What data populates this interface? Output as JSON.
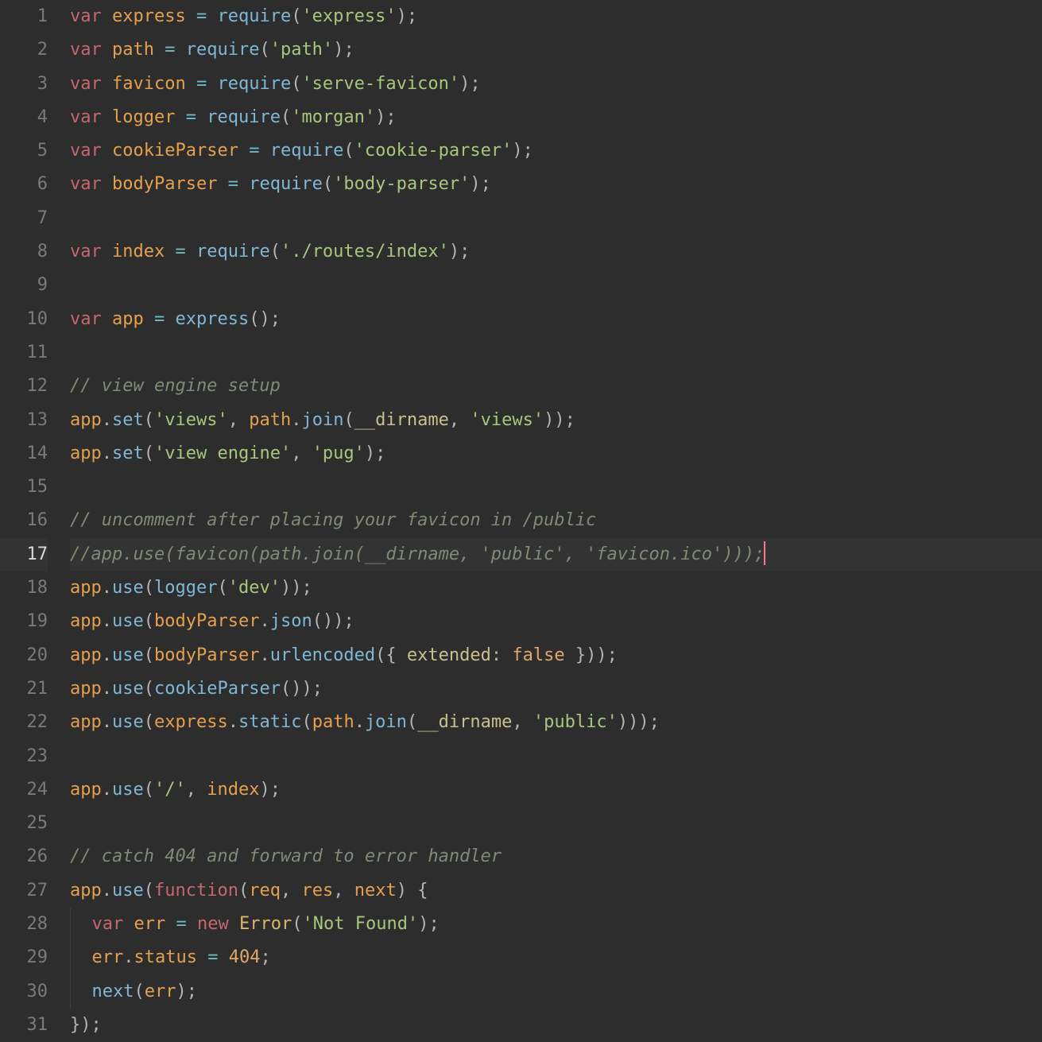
{
  "editor": {
    "current_line": 17,
    "lines": [
      {
        "n": 1,
        "tokens": [
          [
            "kw",
            "var"
          ],
          [
            "sp",
            " "
          ],
          [
            "id",
            "express"
          ],
          [
            "sp",
            " "
          ],
          [
            "op",
            "="
          ],
          [
            "sp",
            " "
          ],
          [
            "call",
            "require"
          ],
          [
            "punc",
            "("
          ],
          [
            "str",
            "'express'"
          ],
          [
            "punc",
            ")"
          ],
          [
            "punc",
            ";"
          ]
        ]
      },
      {
        "n": 2,
        "tokens": [
          [
            "kw",
            "var"
          ],
          [
            "sp",
            " "
          ],
          [
            "id",
            "path"
          ],
          [
            "sp",
            " "
          ],
          [
            "op",
            "="
          ],
          [
            "sp",
            " "
          ],
          [
            "call",
            "require"
          ],
          [
            "punc",
            "("
          ],
          [
            "str",
            "'path'"
          ],
          [
            "punc",
            ")"
          ],
          [
            "punc",
            ";"
          ]
        ]
      },
      {
        "n": 3,
        "tokens": [
          [
            "kw",
            "var"
          ],
          [
            "sp",
            " "
          ],
          [
            "id",
            "favicon"
          ],
          [
            "sp",
            " "
          ],
          [
            "op",
            "="
          ],
          [
            "sp",
            " "
          ],
          [
            "call",
            "require"
          ],
          [
            "punc",
            "("
          ],
          [
            "str",
            "'serve-favicon'"
          ],
          [
            "punc",
            ")"
          ],
          [
            "punc",
            ";"
          ]
        ]
      },
      {
        "n": 4,
        "tokens": [
          [
            "kw",
            "var"
          ],
          [
            "sp",
            " "
          ],
          [
            "id",
            "logger"
          ],
          [
            "sp",
            " "
          ],
          [
            "op",
            "="
          ],
          [
            "sp",
            " "
          ],
          [
            "call",
            "require"
          ],
          [
            "punc",
            "("
          ],
          [
            "str",
            "'morgan'"
          ],
          [
            "punc",
            ")"
          ],
          [
            "punc",
            ";"
          ]
        ]
      },
      {
        "n": 5,
        "tokens": [
          [
            "kw",
            "var"
          ],
          [
            "sp",
            " "
          ],
          [
            "id",
            "cookieParser"
          ],
          [
            "sp",
            " "
          ],
          [
            "op",
            "="
          ],
          [
            "sp",
            " "
          ],
          [
            "call",
            "require"
          ],
          [
            "punc",
            "("
          ],
          [
            "str",
            "'cookie-parser'"
          ],
          [
            "punc",
            ")"
          ],
          [
            "punc",
            ";"
          ]
        ]
      },
      {
        "n": 6,
        "tokens": [
          [
            "kw",
            "var"
          ],
          [
            "sp",
            " "
          ],
          [
            "id",
            "bodyParser"
          ],
          [
            "sp",
            " "
          ],
          [
            "op",
            "="
          ],
          [
            "sp",
            " "
          ],
          [
            "call",
            "require"
          ],
          [
            "punc",
            "("
          ],
          [
            "str",
            "'body-parser'"
          ],
          [
            "punc",
            ")"
          ],
          [
            "punc",
            ";"
          ]
        ]
      },
      {
        "n": 7,
        "tokens": []
      },
      {
        "n": 8,
        "tokens": [
          [
            "kw",
            "var"
          ],
          [
            "sp",
            " "
          ],
          [
            "id",
            "index"
          ],
          [
            "sp",
            " "
          ],
          [
            "op",
            "="
          ],
          [
            "sp",
            " "
          ],
          [
            "call",
            "require"
          ],
          [
            "punc",
            "("
          ],
          [
            "str",
            "'./routes/index'"
          ],
          [
            "punc",
            ")"
          ],
          [
            "punc",
            ";"
          ]
        ]
      },
      {
        "n": 9,
        "tokens": []
      },
      {
        "n": 10,
        "tokens": [
          [
            "kw",
            "var"
          ],
          [
            "sp",
            " "
          ],
          [
            "id",
            "app"
          ],
          [
            "sp",
            " "
          ],
          [
            "op",
            "="
          ],
          [
            "sp",
            " "
          ],
          [
            "call",
            "express"
          ],
          [
            "punc",
            "("
          ],
          [
            "punc",
            ")"
          ],
          [
            "punc",
            ";"
          ]
        ]
      },
      {
        "n": 11,
        "tokens": []
      },
      {
        "n": 12,
        "tokens": [
          [
            "cmt",
            "// view engine setup"
          ]
        ]
      },
      {
        "n": 13,
        "tokens": [
          [
            "id",
            "app"
          ],
          [
            "punc",
            "."
          ],
          [
            "call",
            "set"
          ],
          [
            "punc",
            "("
          ],
          [
            "str",
            "'views'"
          ],
          [
            "punc",
            ","
          ],
          [
            "sp",
            " "
          ],
          [
            "id",
            "path"
          ],
          [
            "punc",
            "."
          ],
          [
            "call",
            "join"
          ],
          [
            "punc",
            "("
          ],
          [
            "dir",
            "__dirname"
          ],
          [
            "punc",
            ","
          ],
          [
            "sp",
            " "
          ],
          [
            "str",
            "'views'"
          ],
          [
            "punc",
            ")"
          ],
          [
            "punc",
            ")"
          ],
          [
            "punc",
            ";"
          ]
        ]
      },
      {
        "n": 14,
        "tokens": [
          [
            "id",
            "app"
          ],
          [
            "punc",
            "."
          ],
          [
            "call",
            "set"
          ],
          [
            "punc",
            "("
          ],
          [
            "str",
            "'view engine'"
          ],
          [
            "punc",
            ","
          ],
          [
            "sp",
            " "
          ],
          [
            "str",
            "'pug'"
          ],
          [
            "punc",
            ")"
          ],
          [
            "punc",
            ";"
          ]
        ]
      },
      {
        "n": 15,
        "tokens": []
      },
      {
        "n": 16,
        "tokens": [
          [
            "cmt",
            "// uncomment after placing your favicon in /public"
          ]
        ]
      },
      {
        "n": 17,
        "tokens": [
          [
            "cmt",
            "//app.use(favicon(path.join(__dirname, 'public', 'favicon.ico')));"
          ]
        ],
        "cursor_after": true
      },
      {
        "n": 18,
        "tokens": [
          [
            "id",
            "app"
          ],
          [
            "punc",
            "."
          ],
          [
            "call",
            "use"
          ],
          [
            "punc",
            "("
          ],
          [
            "call",
            "logger"
          ],
          [
            "punc",
            "("
          ],
          [
            "str",
            "'dev'"
          ],
          [
            "punc",
            ")"
          ],
          [
            "punc",
            ")"
          ],
          [
            "punc",
            ";"
          ]
        ]
      },
      {
        "n": 19,
        "tokens": [
          [
            "id",
            "app"
          ],
          [
            "punc",
            "."
          ],
          [
            "call",
            "use"
          ],
          [
            "punc",
            "("
          ],
          [
            "id",
            "bodyParser"
          ],
          [
            "punc",
            "."
          ],
          [
            "call",
            "json"
          ],
          [
            "punc",
            "("
          ],
          [
            "punc",
            ")"
          ],
          [
            "punc",
            ")"
          ],
          [
            "punc",
            ";"
          ]
        ]
      },
      {
        "n": 20,
        "tokens": [
          [
            "id",
            "app"
          ],
          [
            "punc",
            "."
          ],
          [
            "call",
            "use"
          ],
          [
            "punc",
            "("
          ],
          [
            "id",
            "bodyParser"
          ],
          [
            "punc",
            "."
          ],
          [
            "call",
            "urlencoded"
          ],
          [
            "punc",
            "("
          ],
          [
            "punc",
            "{"
          ],
          [
            "sp",
            " "
          ],
          [
            "prop",
            "extended"
          ],
          [
            "punc",
            ":"
          ],
          [
            "sp",
            " "
          ],
          [
            "bool",
            "false"
          ],
          [
            "sp",
            " "
          ],
          [
            "punc",
            "}"
          ],
          [
            "punc",
            ")"
          ],
          [
            "punc",
            ")"
          ],
          [
            "punc",
            ";"
          ]
        ]
      },
      {
        "n": 21,
        "tokens": [
          [
            "id",
            "app"
          ],
          [
            "punc",
            "."
          ],
          [
            "call",
            "use"
          ],
          [
            "punc",
            "("
          ],
          [
            "call",
            "cookieParser"
          ],
          [
            "punc",
            "("
          ],
          [
            "punc",
            ")"
          ],
          [
            "punc",
            ")"
          ],
          [
            "punc",
            ";"
          ]
        ]
      },
      {
        "n": 22,
        "tokens": [
          [
            "id",
            "app"
          ],
          [
            "punc",
            "."
          ],
          [
            "call",
            "use"
          ],
          [
            "punc",
            "("
          ],
          [
            "id",
            "express"
          ],
          [
            "punc",
            "."
          ],
          [
            "call",
            "static"
          ],
          [
            "punc",
            "("
          ],
          [
            "id",
            "path"
          ],
          [
            "punc",
            "."
          ],
          [
            "call",
            "join"
          ],
          [
            "punc",
            "("
          ],
          [
            "dir",
            "__dirname"
          ],
          [
            "punc",
            ","
          ],
          [
            "sp",
            " "
          ],
          [
            "str",
            "'public'"
          ],
          [
            "punc",
            ")"
          ],
          [
            "punc",
            ")"
          ],
          [
            "punc",
            ")"
          ],
          [
            "punc",
            ";"
          ]
        ]
      },
      {
        "n": 23,
        "tokens": []
      },
      {
        "n": 24,
        "tokens": [
          [
            "id",
            "app"
          ],
          [
            "punc",
            "."
          ],
          [
            "call",
            "use"
          ],
          [
            "punc",
            "("
          ],
          [
            "str",
            "'/'"
          ],
          [
            "punc",
            ","
          ],
          [
            "sp",
            " "
          ],
          [
            "id",
            "index"
          ],
          [
            "punc",
            ")"
          ],
          [
            "punc",
            ";"
          ]
        ]
      },
      {
        "n": 25,
        "tokens": []
      },
      {
        "n": 26,
        "tokens": [
          [
            "cmt",
            "// catch 404 and forward to error handler"
          ]
        ]
      },
      {
        "n": 27,
        "tokens": [
          [
            "id",
            "app"
          ],
          [
            "punc",
            "."
          ],
          [
            "call",
            "use"
          ],
          [
            "punc",
            "("
          ],
          [
            "kw",
            "function"
          ],
          [
            "punc",
            "("
          ],
          [
            "param",
            "req"
          ],
          [
            "punc",
            ","
          ],
          [
            "sp",
            " "
          ],
          [
            "param",
            "res"
          ],
          [
            "punc",
            ","
          ],
          [
            "sp",
            " "
          ],
          [
            "param",
            "next"
          ],
          [
            "punc",
            ")"
          ],
          [
            "sp",
            " "
          ],
          [
            "punc",
            "{"
          ]
        ]
      },
      {
        "n": 28,
        "indent": 1,
        "tokens": [
          [
            "kw",
            "var"
          ],
          [
            "sp",
            " "
          ],
          [
            "id",
            "err"
          ],
          [
            "sp",
            " "
          ],
          [
            "op",
            "="
          ],
          [
            "sp",
            " "
          ],
          [
            "kw",
            "new"
          ],
          [
            "sp",
            " "
          ],
          [
            "cls",
            "Error"
          ],
          [
            "punc",
            "("
          ],
          [
            "str",
            "'Not Found'"
          ],
          [
            "punc",
            ")"
          ],
          [
            "punc",
            ";"
          ]
        ]
      },
      {
        "n": 29,
        "indent": 1,
        "tokens": [
          [
            "id",
            "err"
          ],
          [
            "punc",
            "."
          ],
          [
            "id",
            "status"
          ],
          [
            "sp",
            " "
          ],
          [
            "op",
            "="
          ],
          [
            "sp",
            " "
          ],
          [
            "num",
            "404"
          ],
          [
            "punc",
            ";"
          ]
        ]
      },
      {
        "n": 30,
        "indent": 1,
        "tokens": [
          [
            "call",
            "next"
          ],
          [
            "punc",
            "("
          ],
          [
            "id",
            "err"
          ],
          [
            "punc",
            ")"
          ],
          [
            "punc",
            ";"
          ]
        ]
      },
      {
        "n": 31,
        "tokens": [
          [
            "punc",
            "}"
          ],
          [
            "punc",
            ")"
          ],
          [
            "punc",
            ";"
          ]
        ]
      }
    ]
  }
}
